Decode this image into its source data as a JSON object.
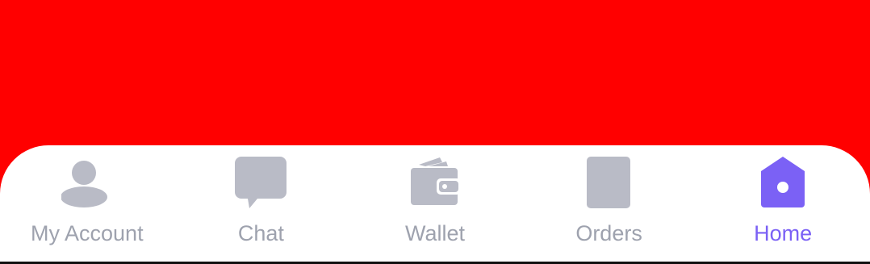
{
  "colors": {
    "background": "#FF0000",
    "inactive": "#B9BBC6",
    "inactive_text": "#9EA2AE",
    "active": "#7B61F5"
  },
  "bottom_nav": {
    "items": [
      {
        "label": "My Account",
        "icon": "person-icon",
        "active": false
      },
      {
        "label": "Chat",
        "icon": "chat-bubble-icon",
        "active": false
      },
      {
        "label": "Wallet",
        "icon": "wallet-icon",
        "active": false
      },
      {
        "label": "Orders",
        "icon": "orders-icon",
        "active": false
      },
      {
        "label": "Home",
        "icon": "home-icon",
        "active": true
      }
    ]
  }
}
